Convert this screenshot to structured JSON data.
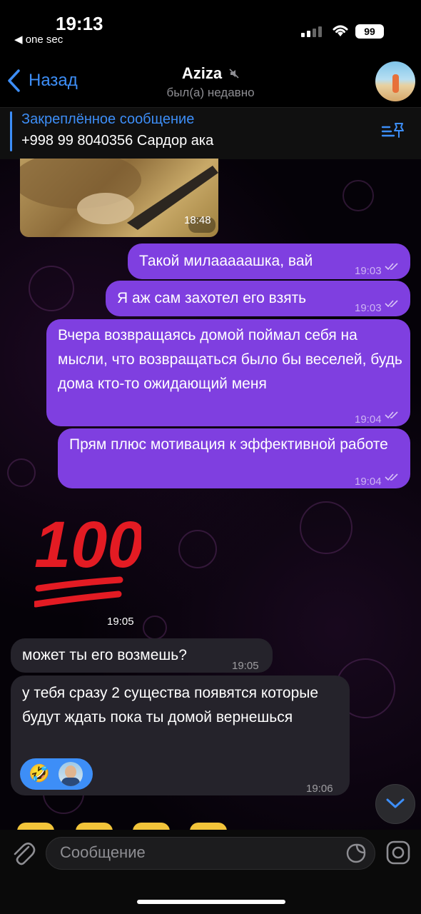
{
  "status_bar": {
    "time": "19:13",
    "back_app": "◀ one sec",
    "battery": "99"
  },
  "header": {
    "back_label": "Назад",
    "title": "Aziza",
    "subtitle": "был(а) недавно"
  },
  "pinned": {
    "title": "Закреплённое сообщение",
    "text": "+998 99 8040356 Сардор ака"
  },
  "messages": [
    {
      "dir": "in",
      "type": "photo",
      "time": "18:48"
    },
    {
      "dir": "out",
      "text": "Такой милааааашка, вай",
      "time": "19:03"
    },
    {
      "dir": "out",
      "text": "Я аж сам захотел его взять",
      "time": "19:03"
    },
    {
      "dir": "out",
      "text": "Вчера возвращаясь домой поймал себя на мысли, что возвращаться было бы веселей, будь дома кто-то ожидающий меня",
      "time": "19:04"
    },
    {
      "dir": "out",
      "text": "Прям плюс мотивация к эффективной работе",
      "time": "19:04"
    },
    {
      "dir": "in",
      "type": "emoji",
      "text": "100",
      "time": "19:05"
    },
    {
      "dir": "in",
      "text": "может ты его возмешь?",
      "time": "19:05"
    },
    {
      "dir": "in",
      "text": "у тебя сразу 2 существа появятся которые будут ждать пока ты домой вернешься",
      "time": "19:06",
      "reaction": "🤣"
    }
  ],
  "composer": {
    "placeholder": "Сообщение"
  }
}
